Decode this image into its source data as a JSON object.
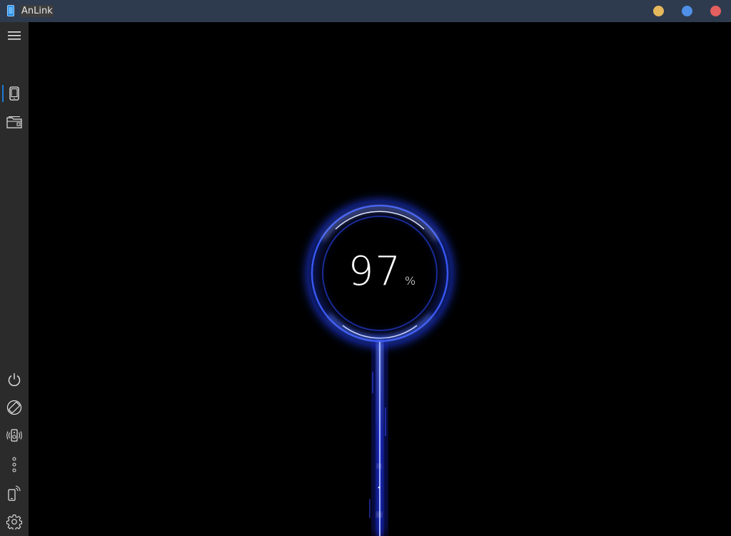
{
  "window": {
    "title": "AnLink",
    "controls": {
      "minimize_color": "#e5b85c",
      "maximize_color": "#4f8fe6",
      "close_color": "#e45f5f"
    }
  },
  "sidebar": {
    "top_items": [
      {
        "name": "menu-icon",
        "active": false
      },
      {
        "name": "phone-icon",
        "active": true
      },
      {
        "name": "file-manager-icon",
        "active": false
      }
    ],
    "bottom_items": [
      {
        "name": "power-icon"
      },
      {
        "name": "rotate-screen-icon"
      },
      {
        "name": "speaker-icon"
      },
      {
        "name": "more-icon"
      },
      {
        "name": "phone-cast-icon"
      },
      {
        "name": "settings-icon"
      }
    ],
    "accent_color": "#1e7ad6"
  },
  "main": {
    "battery": {
      "value": "97",
      "unit": "%",
      "level": 0.97,
      "glow_color": "#2f5bff"
    }
  }
}
